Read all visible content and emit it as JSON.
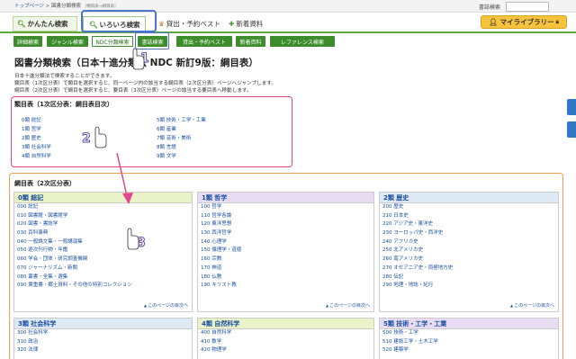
{
  "topbar": {
    "breadcrumb_home": "トップページ",
    "breadcrumb_sep": ">",
    "breadcrumb_current": "図書分類検索",
    "breadcrumb_sub": "（類目表→綱目表）",
    "site_search_label": "書誌検索"
  },
  "main_tabs": {
    "simple": "かんたん検索",
    "various": "いろいろ検索",
    "best": "貸出・予約ベスト",
    "new": "新着資料"
  },
  "mylibrary": "マイライブラリー",
  "subnav": [
    "詳細検索",
    "ジャンル検索",
    "NDC分類検索",
    "書誌検索",
    "貸出・予約ベスト",
    "新着資料",
    "レファレンス検索"
  ],
  "page_title": "図書分類検索（日本十進分類法 NDC 新訂9版：綱目表）",
  "intro": [
    "日本十進分類法で検索することができます。",
    "類目表（1次区分表）で類目を選択すると、同一ページ内の該当する綱目表（2次区分表）ページへジャンプします。",
    "綱目表（2次区分表）で綱目を選択すると、要目表（3次区分表）ページの該当する要目表へ移動します。"
  ],
  "class_box": {
    "title": "類目表（1次区分表：綱目表目次）",
    "col1": [
      "0類 総記",
      "1類 哲学",
      "2類 歴史",
      "3類 社会科学",
      "4類 自然科学"
    ],
    "col2": [
      "5類 技術・工学・工業",
      "6類 産業",
      "7類 芸術・美術",
      "8類 言語",
      "9類 文学"
    ]
  },
  "div_box": {
    "title": "綱目表（2次区分表）",
    "more_label": "このページの目次へ",
    "panels": [
      {
        "head": "0類 総記",
        "items": [
          "000 総記",
          "010 図書館・図書館学",
          "020 図書・書誌学",
          "030 百科事典",
          "040 一般論文集・一般講演集",
          "050 逐次刊行物・年鑑",
          "060 学会・団体・研究調査機関",
          "070 ジャーナリズム・新聞",
          "080 叢書・全集・選集",
          "090 貴重書・郷土資料・その他の特別コレクション"
        ]
      },
      {
        "head": "1類 哲学",
        "items": [
          "100 哲学",
          "110 哲学各論",
          "120 東洋思想",
          "130 西洋哲学",
          "140 心理学",
          "150 倫理学・道徳",
          "160 宗教",
          "170 神道",
          "180 仏教",
          "190 キリスト教"
        ]
      },
      {
        "head": "2類 歴史",
        "items": [
          "200 歴史",
          "210 日本史",
          "220 アジア史・東洋史",
          "230 ヨーロッパ史・西洋史",
          "240 アフリカ史",
          "250 北アメリカ史",
          "260 南アメリカ史",
          "270 オセアニア史・両極地方史",
          "280 伝記",
          "290 地理・地誌・紀行"
        ]
      },
      {
        "head": "3類 社会科学",
        "items": [
          "300 社会科学",
          "310 政治",
          "320 法律"
        ]
      },
      {
        "head": "4類 自然科学",
        "items": [
          "400 自然科学",
          "410 数学",
          "420 物理学"
        ]
      },
      {
        "head": "5類 技術・工学・工業",
        "items": [
          "500 技術・工学",
          "510 建設工学・土木工学",
          "520 建築学"
        ]
      }
    ]
  },
  "annotations": [
    "1",
    "2",
    "3"
  ],
  "colors": {
    "green": "#3d8c2c",
    "pink": "#e2478f",
    "orange": "#f0a050",
    "blue": "#4a76c8",
    "link": "#1a4fa0"
  }
}
